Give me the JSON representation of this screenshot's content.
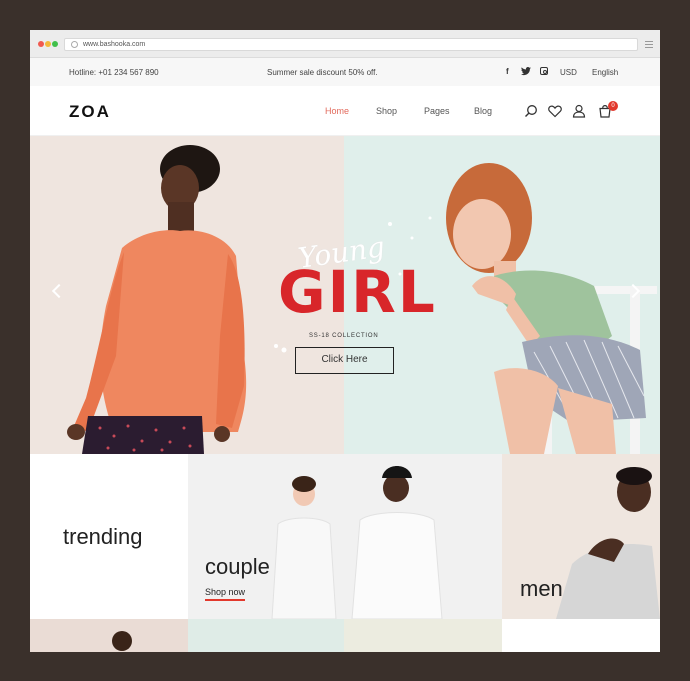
{
  "browser": {
    "url": "www.bashooka.com"
  },
  "topbar": {
    "hotline": "Hotline: +01 234 567 890",
    "promo": "Summer sale discount 50% off.",
    "social": {
      "facebook": "f",
      "twitter": "t"
    },
    "currency": "USD",
    "language": "English"
  },
  "header": {
    "logo": "ZOA",
    "nav": [
      "Home",
      "Shop",
      "Pages",
      "Blog"
    ],
    "cart_count": "0"
  },
  "hero": {
    "script_word": "Young",
    "headline": "GIRL",
    "collection": "SS-18 COLLECTION",
    "button": "Click Here"
  },
  "categories": {
    "trending": "trending",
    "couple": "couple",
    "couple_link": "Shop now",
    "men": "men"
  },
  "colors": {
    "accent": "#d8262a",
    "nav_active": "#e26a5c",
    "frame": "#3a302b"
  }
}
